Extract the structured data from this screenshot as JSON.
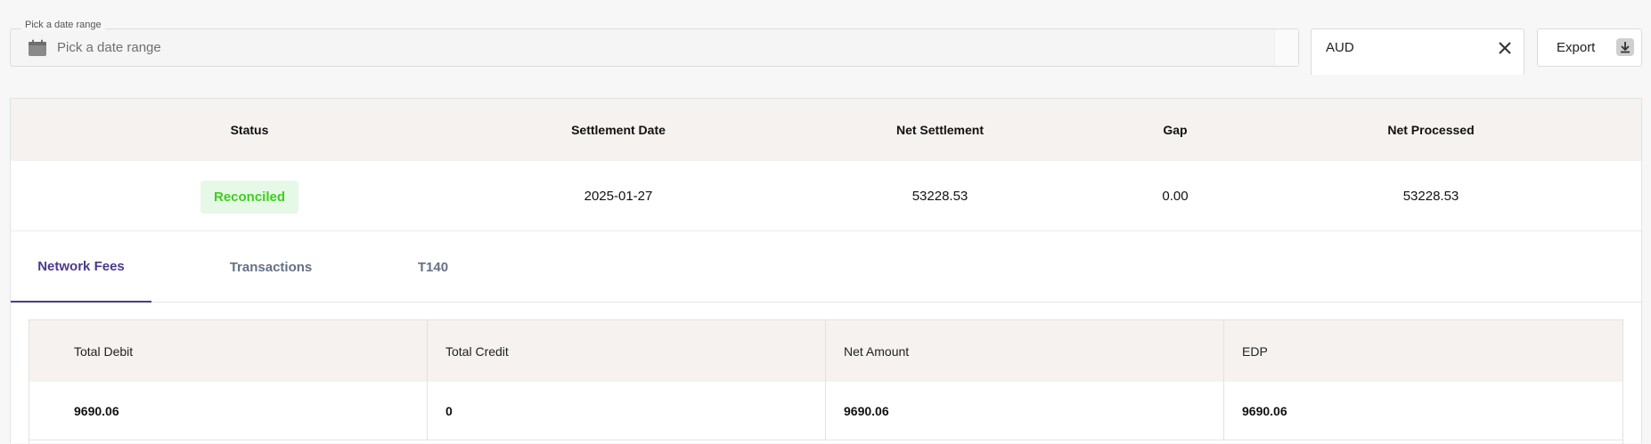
{
  "filters": {
    "date_range_label": "Pick a date range",
    "date_range_placeholder": "Pick a date range",
    "currency_value": "AUD",
    "export_label": "Export"
  },
  "summary": {
    "headers": [
      "Status",
      "Settlement Date",
      "Net Settlement",
      "Gap",
      "Net Processed"
    ],
    "row": {
      "status": "Reconciled",
      "settlement_date": "2025-01-27",
      "net_settlement": "53228.53",
      "gap": "0.00",
      "net_processed": "53228.53"
    }
  },
  "tabs": [
    {
      "label": "Network Fees",
      "active": true
    },
    {
      "label": "Transactions",
      "active": false
    },
    {
      "label": "T140",
      "active": false
    }
  ],
  "fees_table": {
    "headers": [
      "Total Debit",
      "Total Credit",
      "Net Amount",
      "EDP"
    ],
    "row": [
      "9690.06",
      "0",
      "9690.06",
      "9690.06"
    ]
  },
  "colors": {
    "accent": "#4b3a8c",
    "status_green": "#3dcf1e",
    "status_bg": "#e6f8e6",
    "header_bg": "#f5f2ef"
  },
  "icons": {
    "date": "calendar-icon",
    "clear": "close-icon",
    "export": "download-icon"
  }
}
